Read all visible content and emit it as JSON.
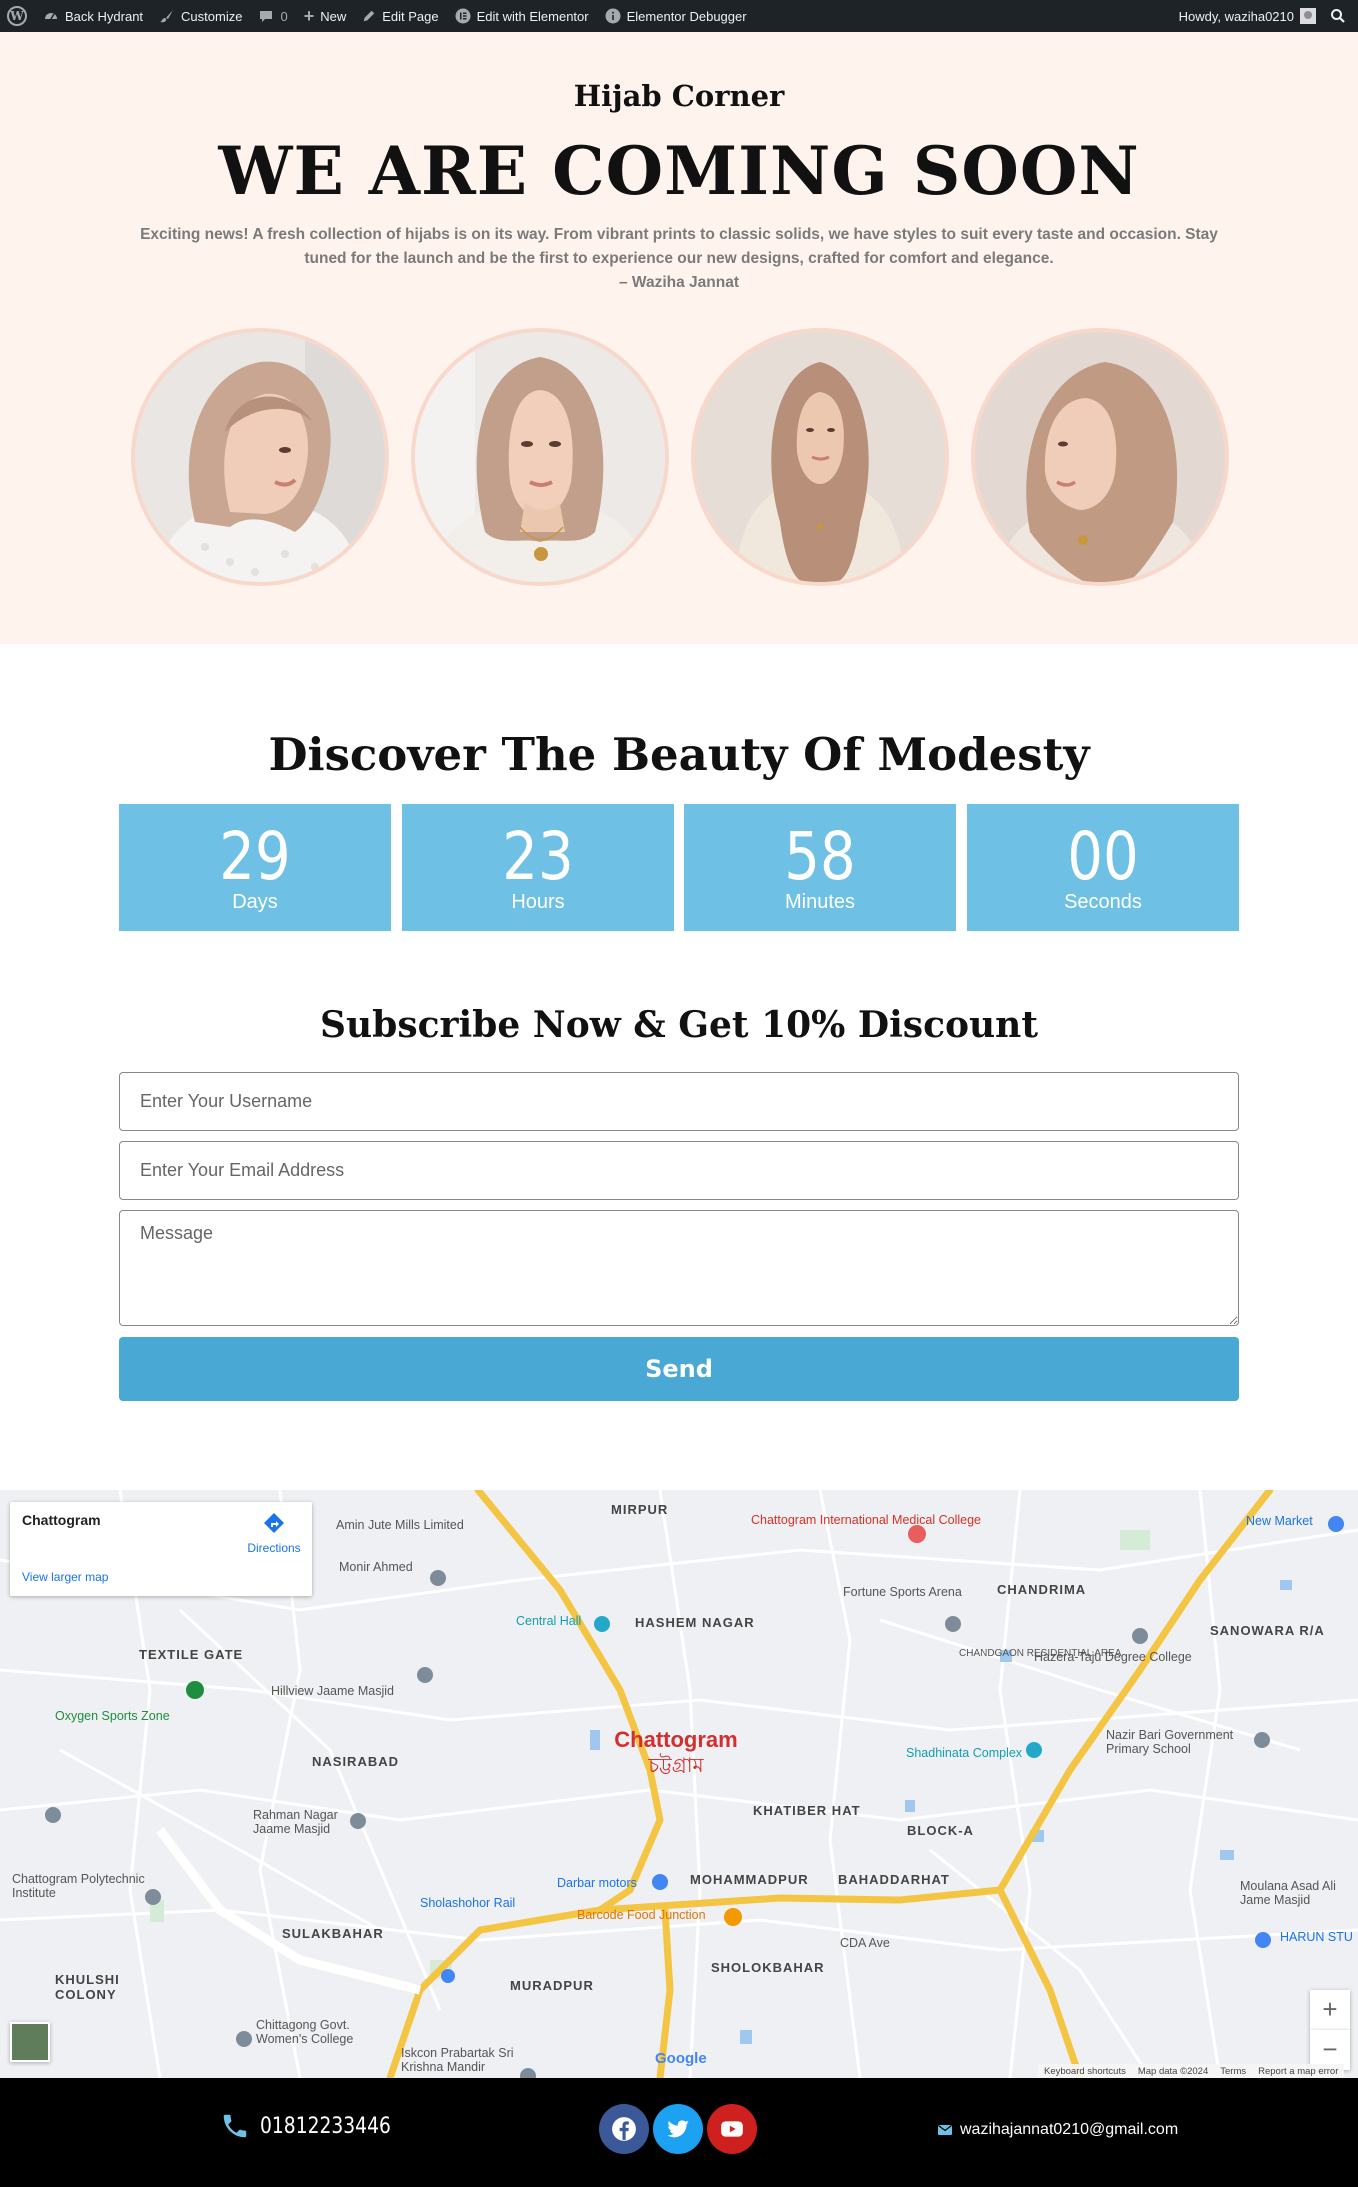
{
  "admin_bar": {
    "items": [
      {
        "label": "Back Hydrant",
        "icon": "dashboard-icon"
      },
      {
        "label": "Customize",
        "icon": "brush-icon"
      },
      {
        "label": "0",
        "icon": "comment-icon"
      },
      {
        "label": "New",
        "icon": "plus-icon"
      },
      {
        "label": "Edit Page",
        "icon": "pencil-icon"
      },
      {
        "label": "Edit with Elementor",
        "icon": "elementor-icon"
      },
      {
        "label": "Elementor Debugger",
        "icon": "info-icon"
      }
    ],
    "greeting": "Howdy, waziha0210"
  },
  "hero": {
    "brand": "Hijab Corner",
    "title": "WE ARE COMING SOON",
    "text": "Exciting news! A fresh collection of hijabs is on its way. From vibrant prints to classic solids, we have styles to suit every taste and occasion. Stay tuned for the launch and be the first to experience our new designs, crafted for comfort and elegance.",
    "author": "– Waziha Jannat"
  },
  "countdown": {
    "heading": "Discover The Beauty Of Modesty",
    "units": [
      {
        "value": "29",
        "label": "Days"
      },
      {
        "value": "23",
        "label": "Hours"
      },
      {
        "value": "58",
        "label": "Minutes"
      },
      {
        "value": "00",
        "label": "Seconds"
      }
    ]
  },
  "subscribe": {
    "heading": "Subscribe Now & Get 10% Discount",
    "username_placeholder": "Enter Your Username",
    "email_placeholder": "Enter Your Email Address",
    "message_placeholder": "Message",
    "send_label": "Send"
  },
  "map": {
    "place_name": "Chattogram",
    "directions_label": "Directions",
    "larger_map_label": "View larger map",
    "city_label": "Chattogram",
    "city_label_bn": "চট্টগ্রাম",
    "labels": [
      "Amin Jute Mills Limited",
      "MIRPUR",
      "Chattogram International Medical College",
      "New Market",
      "Monir Ahmed",
      "HASHEM NAGAR",
      "Fortune Sports Arena",
      "CHANDRIMA",
      "TEXTILE GATE",
      "Central Hall",
      "SANOWARA R/A",
      "Hillview Jaame Masjid",
      "CHANDGAON RESIDENTIAL AREA",
      "Hazera-Taju Degree College",
      "Oxygen Sports Zone",
      "NASIRABAD",
      "Nazir Bari Government Primary School",
      "Shadhinata Complex",
      "Rahman Nagar Jaame Masjid",
      "KHATIBER HAT",
      "BLOCK-A",
      "Chattogram Polytechnic Institute",
      "Darbar motors",
      "MOHAMMADPUR",
      "BAHADDARHAT",
      "Sholashohor Rail",
      "Moulana Asad Ali Jame Masjid",
      "SULAKBAHAR",
      "Barcode Food Junction",
      "CDA Ave",
      "HARUN STU",
      "KHULSHI COLONY",
      "MURADPUR",
      "SHOLOKBAHAR",
      "Chittagong Govt. Women's College",
      "Iskcon Prabartak Sri Krishna Mandir",
      "Google"
    ],
    "attribution": [
      "Keyboard shortcuts",
      "Map data ©2024",
      "Terms",
      "Report a map error"
    ]
  },
  "footer": {
    "phone": "01812233446",
    "email": "wazihajannat0210@gmail.com",
    "social": [
      {
        "name": "facebook-icon",
        "color": "#3b5998"
      },
      {
        "name": "twitter-icon",
        "color": "#1da1f2"
      },
      {
        "name": "youtube-icon",
        "color": "#cd201f"
      }
    ]
  },
  "colors": {
    "hero_bg": "#fff3ee",
    "countdown_bg": "#6ec1e4",
    "send_button": "#4aa8d4",
    "admin_bar": "#1d2327",
    "footer_bg": "#000000"
  }
}
